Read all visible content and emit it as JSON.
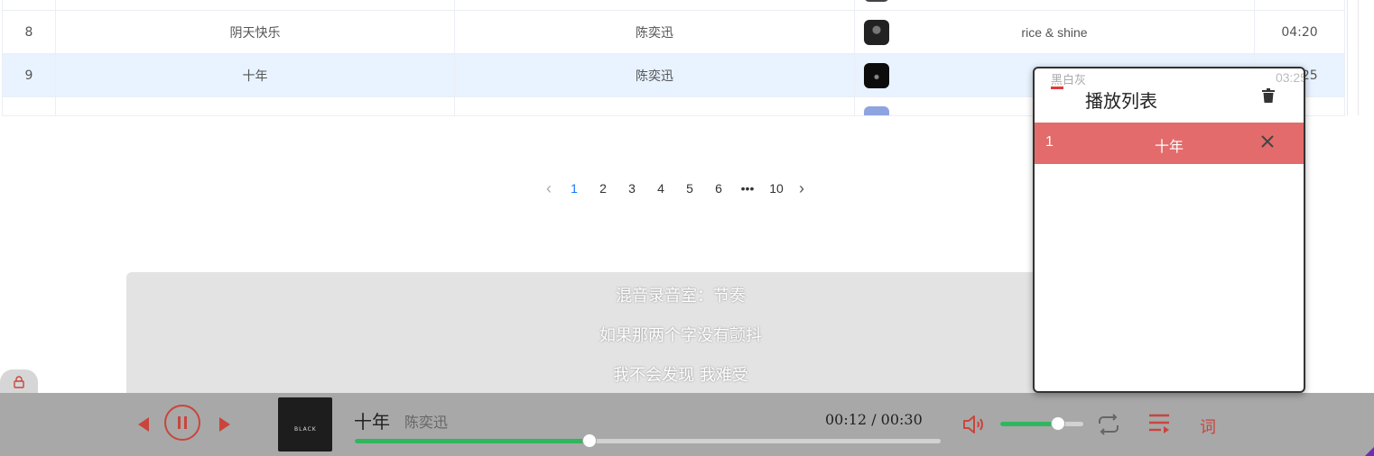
{
  "table": {
    "rows": [
      {
        "idx": "",
        "title": "",
        "artist": "",
        "album": "",
        "duration": "",
        "thumb": "t7"
      },
      {
        "idx": "8",
        "title": "阴天快乐",
        "artist": "陈奕迅",
        "album": "rice & shine",
        "duration": "04:20",
        "thumb": "t8"
      },
      {
        "idx": "9",
        "title": "十年",
        "artist": "陈奕迅",
        "album": "黑白灰",
        "duration": "03:25",
        "thumb": "t9",
        "highlighted": true
      },
      {
        "idx": "",
        "title": "",
        "artist": "",
        "album": "",
        "duration": "",
        "thumb": "t10"
      }
    ]
  },
  "pagination": {
    "current": "1",
    "pages": [
      "1",
      "2",
      "3",
      "4",
      "5",
      "6",
      "•••",
      "10"
    ]
  },
  "lyrics": {
    "lines": [
      "混音录音室：节奏",
      "如果那两个字没有颤抖",
      "我不会发现 我难受"
    ]
  },
  "player": {
    "song_title": "十年",
    "artist": "陈奕迅",
    "time": "00:12 / 00:30",
    "progress": 0.4,
    "volume": 0.7,
    "cover_text": "BLACK",
    "lyric_button": "词",
    "accent_color": "#c9453c",
    "progress_color": "#2fb65e"
  },
  "playlist": {
    "title": "播放列表",
    "items": [
      {
        "index": "1",
        "name": "十年"
      }
    ],
    "item_color": "#e36b6b"
  }
}
